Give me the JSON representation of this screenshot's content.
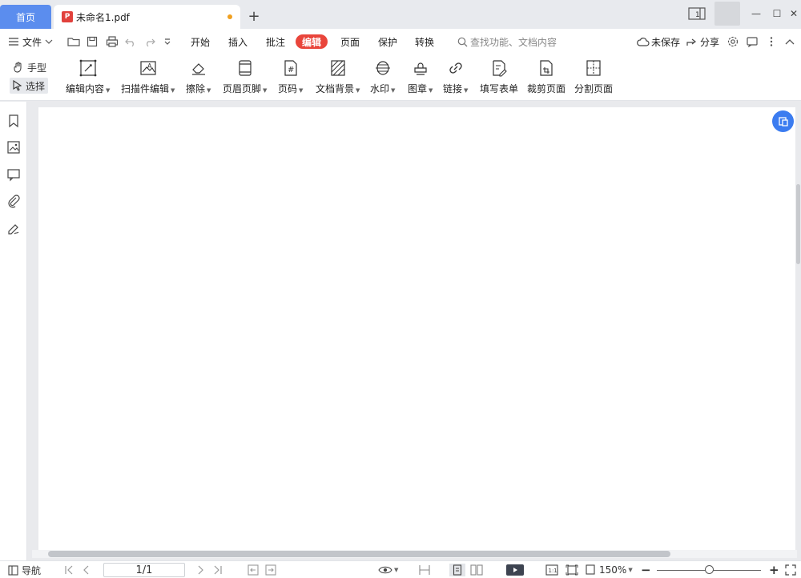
{
  "tabs": {
    "home_label": "首页",
    "doc_label": "未命名1.pdf",
    "doc_badge": "P",
    "new_tab": "+"
  },
  "window": {
    "layout_badge": "1",
    "minimize": "—",
    "maximize": "☐",
    "close": "✕"
  },
  "menubar": {
    "file_label": "文件",
    "items": [
      "开始",
      "插入",
      "批注",
      "编辑",
      "页面",
      "保护",
      "转换"
    ],
    "active_item": "编辑",
    "search_placeholder": "查找功能、文档内容",
    "unsaved_label": "未保存",
    "share_label": "分享"
  },
  "ribbon": {
    "hand_label": "手型",
    "select_label": "选择",
    "tools": [
      {
        "label": "编辑内容",
        "icon": "edit-content-icon",
        "dropdown": true
      },
      {
        "label": "扫描件编辑",
        "icon": "scan-edit-icon",
        "dropdown": true
      },
      {
        "label": "擦除",
        "icon": "eraser-icon",
        "dropdown": true
      },
      {
        "label": "页眉页脚",
        "icon": "header-footer-icon",
        "dropdown": true
      },
      {
        "label": "页码",
        "icon": "page-number-icon",
        "dropdown": true
      },
      {
        "label": "文档背景",
        "icon": "doc-background-icon",
        "dropdown": true
      },
      {
        "label": "水印",
        "icon": "watermark-icon",
        "dropdown": true
      },
      {
        "label": "图章",
        "icon": "stamp-icon",
        "dropdown": true
      },
      {
        "label": "链接",
        "icon": "link-icon",
        "dropdown": true
      },
      {
        "label": "填写表单",
        "icon": "fill-form-icon",
        "dropdown": false
      },
      {
        "label": "裁剪页面",
        "icon": "crop-page-icon",
        "dropdown": false
      },
      {
        "label": "分割页面",
        "icon": "split-page-icon",
        "dropdown": false
      }
    ]
  },
  "sidebar": {
    "icons": [
      "bookmark-icon",
      "thumbnail-icon",
      "comment-icon",
      "attachment-icon",
      "signature-icon"
    ]
  },
  "statusbar": {
    "nav_label": "导航",
    "page_value": "1/1",
    "zoom_value": "150%",
    "zoom_minus": "−",
    "zoom_plus": "+",
    "zoom_level": 0.5
  },
  "colors": {
    "accent": "#e9453b",
    "home_tab": "#5b8dee",
    "float_button": "#3b7cf0"
  }
}
